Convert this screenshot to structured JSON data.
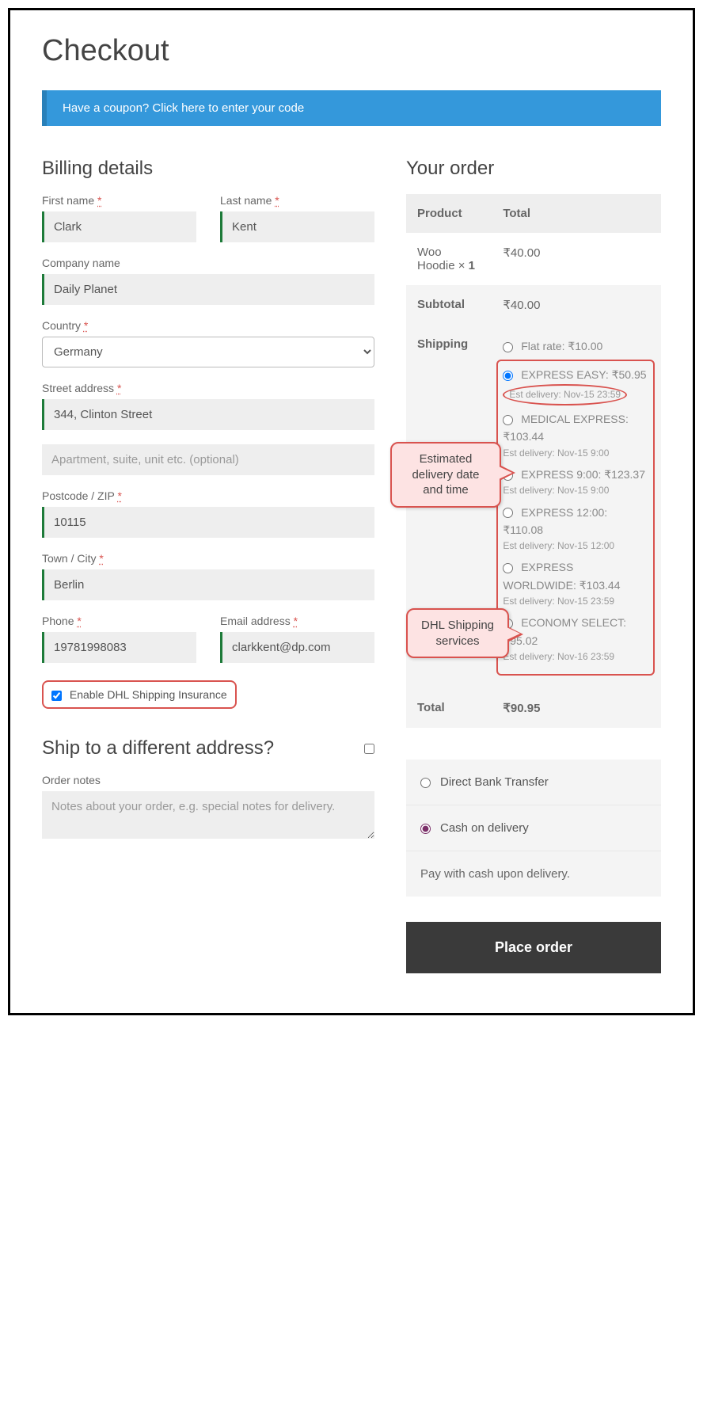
{
  "page_title": "Checkout",
  "coupon_text": "Have a coupon? Click here to enter your code",
  "billing": {
    "heading": "Billing details",
    "labels": {
      "first_name": "First name",
      "last_name": "Last name",
      "company": "Company name",
      "country": "Country",
      "street": "Street address",
      "postcode": "Postcode / ZIP",
      "town": "Town / City",
      "phone": "Phone",
      "email": "Email address"
    },
    "values": {
      "first_name": "Clark",
      "last_name": "Kent",
      "company": "Daily Planet",
      "country": "Germany",
      "street1": "344, Clinton Street",
      "street2_placeholder": "Apartment, suite, unit etc. (optional)",
      "postcode": "10115",
      "town": "Berlin",
      "phone": "19781998083",
      "email": "clarkkent@dp.com"
    },
    "insurance_label": "Enable DHL Shipping Insurance"
  },
  "ship_diff_heading": "Ship to a different address?",
  "order_notes_label": "Order notes",
  "order_notes_placeholder": "Notes about your order, e.g. special notes for delivery.",
  "order": {
    "heading": "Your order",
    "columns": {
      "product": "Product",
      "total": "Total"
    },
    "items": [
      {
        "name": "Woo Hoodie",
        "qty": "1",
        "total": "₹40.00"
      }
    ],
    "subtotal_label": "Subtotal",
    "subtotal": "₹40.00",
    "shipping_label": "Shipping",
    "shipping_options": [
      {
        "label": "Flat rate:",
        "price": "₹10.00",
        "est": "",
        "selected": false,
        "hl": false
      },
      {
        "label": "EXPRESS EASY:",
        "price": "₹50.95",
        "est": "Est delivery: Nov-15 23:59",
        "selected": true,
        "hl": true,
        "est_circled": true
      },
      {
        "label": "MEDICAL EXPRESS:",
        "price": "₹103.44",
        "est": "Est delivery: Nov-15 9:00",
        "selected": false,
        "hl": true
      },
      {
        "label": "EXPRESS 9:00:",
        "price": "₹123.37",
        "est": "Est delivery: Nov-15 9:00",
        "selected": false,
        "hl": true
      },
      {
        "label": "EXPRESS 12:00:",
        "price": "₹110.08",
        "est": "Est delivery: Nov-15 12:00",
        "selected": false,
        "hl": true
      },
      {
        "label": "EXPRESS WORLDWIDE:",
        "price": "₹103.44",
        "est": "Est delivery: Nov-15 23:59",
        "selected": false,
        "hl": true
      },
      {
        "label": "ECONOMY SELECT:",
        "price": "₹95.02",
        "est": "Est delivery: Nov-16 23:59",
        "selected": false,
        "hl": true
      }
    ],
    "total_label": "Total",
    "total": "₹90.95"
  },
  "payment": {
    "options": [
      {
        "label": "Direct Bank Transfer",
        "selected": false
      },
      {
        "label": "Cash on delivery",
        "selected": true
      }
    ],
    "description": "Pay with cash upon delivery."
  },
  "place_order_label": "Place order",
  "callouts": {
    "est": "Estimated delivery date and time",
    "dhl": "DHL Shipping services"
  },
  "required_marker": "*"
}
